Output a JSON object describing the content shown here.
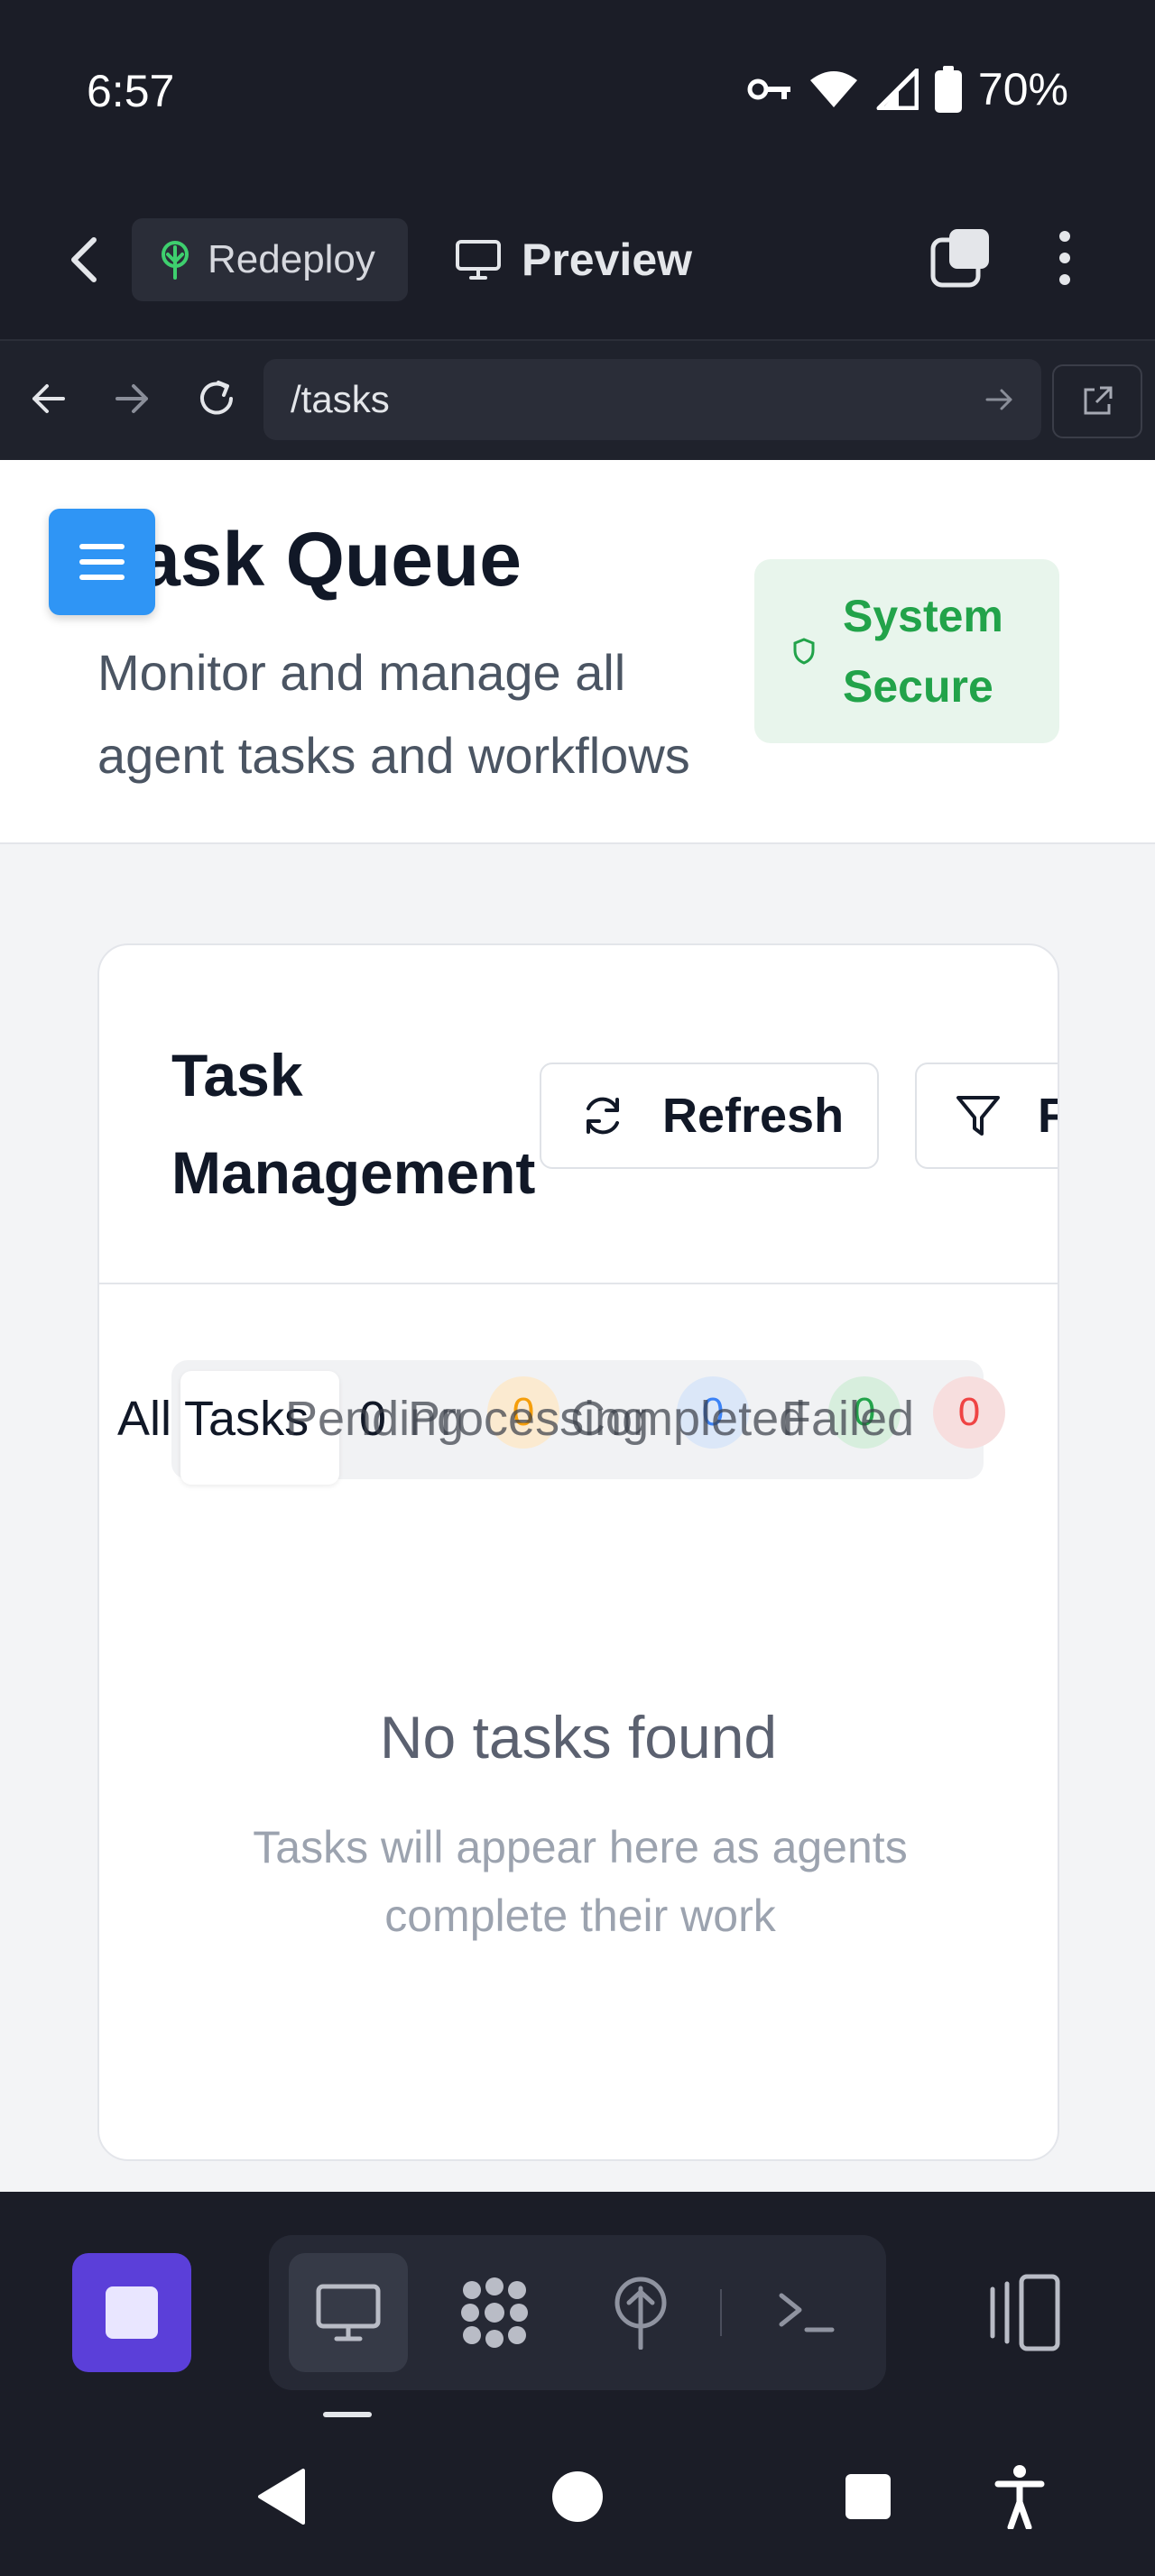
{
  "status_bar": {
    "time": "6:57",
    "battery_percent": "70%",
    "icons": [
      "vpn-key-icon",
      "wifi-icon",
      "signal-icon",
      "battery-icon"
    ]
  },
  "app_toolbar": {
    "redeploy_label": "Redeploy",
    "preview_label": "Preview"
  },
  "url_bar": {
    "url": "/tasks"
  },
  "page": {
    "title": "Task Queue",
    "subtitle": "Monitor and manage all agent tasks and workflows",
    "security_badge": "System Secure"
  },
  "task_card": {
    "title": "Task Management",
    "refresh_label": "Refresh",
    "filter_label": "Filter",
    "tabs": [
      {
        "label": "All Tasks",
        "count": "0",
        "active": true
      },
      {
        "label": "Pending",
        "count": "0",
        "badge_color": "#f59e0b"
      },
      {
        "label": "Processing",
        "count": "0",
        "badge_color": "#3b82f6"
      },
      {
        "label": "Completed",
        "count": "0",
        "badge_color": "#22a34a"
      },
      {
        "label": "Failed",
        "count": "0",
        "badge_color": "#ef4444"
      }
    ],
    "empty_title": "No tasks found",
    "empty_text": "Tasks will appear here as agents complete their work"
  },
  "colors": {
    "accent_blue": "#2f95f5",
    "success_green": "#22a34a",
    "stop_purple": "#5b3fd9",
    "dark_bg": "#1b1d27"
  }
}
